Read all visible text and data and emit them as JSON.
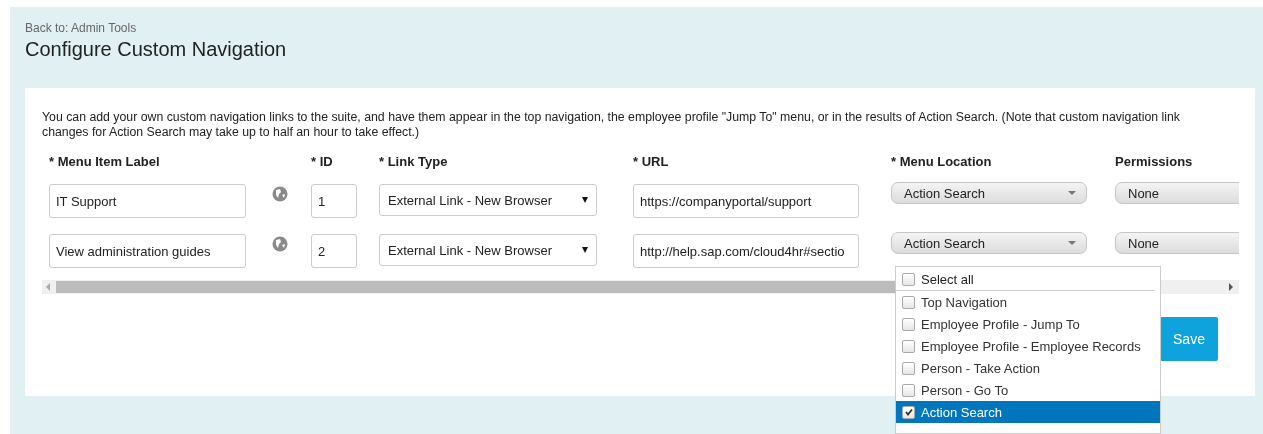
{
  "header": {
    "back_link": "Back to: Admin Tools",
    "title": "Configure Custom Navigation"
  },
  "intro": "You can add your own custom navigation links to the suite, and have them appear in the top navigation, the employee profile \"Jump To\" menu, or in the results of Action Search. (Note that custom navigation link changes for Action Search may take up to half an hour to take effect.)",
  "columns": [
    "* Menu Item Label",
    "* ID",
    "* Link Type",
    "* URL",
    "* Menu Location",
    "Permissions"
  ],
  "rows": [
    {
      "label": "IT Support",
      "id": "1",
      "link_type": "External Link - New Browser",
      "url": "https://companyportal/support",
      "menu_location": "Action Search",
      "permissions": "None"
    },
    {
      "label": "View administration guides",
      "id": "2",
      "link_type": "External Link - New Browser",
      "url": "http://help.sap.com/cloud4hr#sectio",
      "menu_location": "Action Search",
      "permissions": "None"
    }
  ],
  "dropdown": {
    "items": [
      {
        "kind": "select-all",
        "label": "Select all",
        "checked": false,
        "selected": false
      },
      {
        "kind": "option",
        "label": "Top Navigation",
        "checked": false,
        "selected": false
      },
      {
        "kind": "option",
        "label": "Employee Profile - Jump To",
        "checked": false,
        "selected": false
      },
      {
        "kind": "option",
        "label": "Employee Profile - Employee Records",
        "checked": false,
        "selected": false
      },
      {
        "kind": "option",
        "label": "Person - Take Action",
        "checked": false,
        "selected": false
      },
      {
        "kind": "option",
        "label": "Person - Go To",
        "checked": false,
        "selected": false
      },
      {
        "kind": "option",
        "label": "Action Search",
        "checked": true,
        "selected": true
      }
    ]
  },
  "save_button": "Save"
}
